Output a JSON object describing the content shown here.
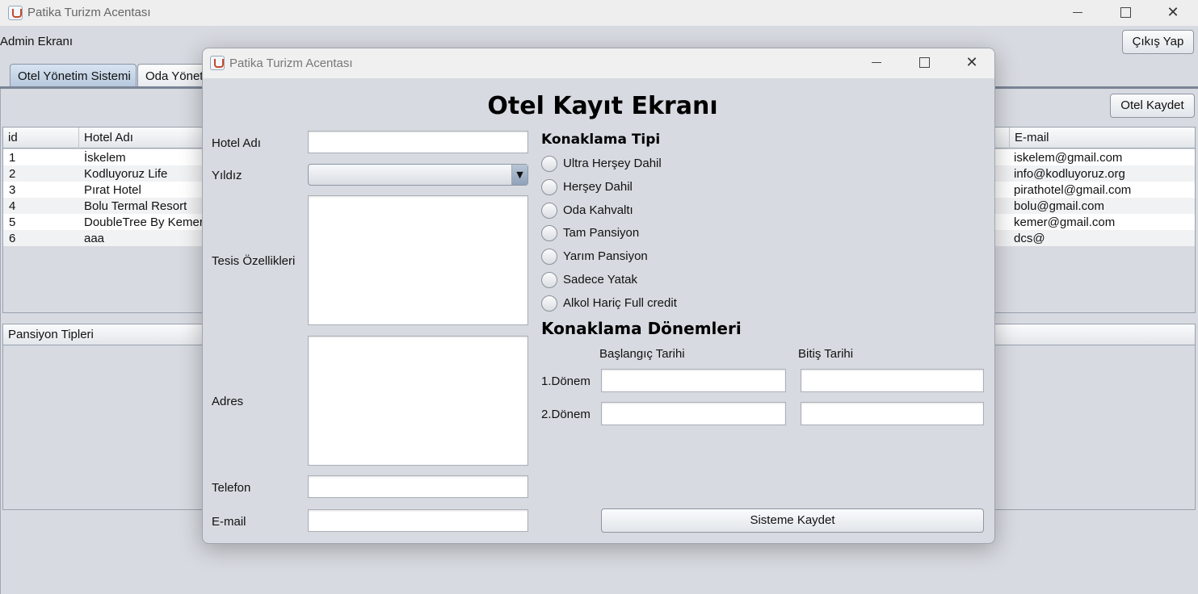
{
  "window": {
    "title": "Patika Turizm Acentası",
    "controls": {
      "minimize": "",
      "maximize": "",
      "close": "✕"
    }
  },
  "header": {
    "admin_label": "Admin Ekranı",
    "logout_label": "Çıkış Yap"
  },
  "tabs": [
    {
      "label": "Otel Yönetim Sistemi",
      "active": true
    },
    {
      "label": "Oda Yönetimi",
      "active": false
    }
  ],
  "hotel_panel": {
    "save_button_label": "Otel Kaydet",
    "table": {
      "columns": {
        "id": "id",
        "name": "Hotel Adı",
        "email": "E-mail"
      },
      "rows": [
        {
          "id": "1",
          "name": "İskelem",
          "email": "iskelem@gmail.com"
        },
        {
          "id": "2",
          "name": "Kodluyoruz Life",
          "email": "info@kodluyoruz.org"
        },
        {
          "id": "3",
          "name": "Pırat Hotel",
          "email": "pirathotel@gmail.com"
        },
        {
          "id": "4",
          "name": "Bolu Termal Resort",
          "email": "bolu@gmail.com"
        },
        {
          "id": "5",
          "name": "DoubleTree By Kemer",
          "email": "kemer@gmail.com"
        },
        {
          "id": "6",
          "name": "aaa",
          "email": "dcs@"
        }
      ]
    },
    "pansiyon_header": "Pansiyon Tipleri"
  },
  "dialog": {
    "window_title": "Patika Turizm Acentası",
    "controls": {
      "minimize": "",
      "maximize": "",
      "close": "✕"
    },
    "heading": "Otel Kayıt Ekranı",
    "fields": {
      "hotel_name": {
        "label": "Hotel Adı",
        "value": ""
      },
      "stars": {
        "label": "Yıldız",
        "value": ""
      },
      "facilities": {
        "label": "Tesis Özellikleri",
        "value": ""
      },
      "address": {
        "label": "Adres",
        "value": ""
      },
      "phone": {
        "label": "Telefon",
        "value": ""
      },
      "email": {
        "label": "E-mail",
        "value": ""
      }
    },
    "accommodation_type": {
      "title": "Konaklama Tipi",
      "options": [
        "Ultra Herşey Dahil",
        "Herşey Dahil",
        "Oda Kahvaltı",
        "Tam Pansiyon",
        "Yarım Pansiyon",
        "Sadece Yatak",
        "Alkol Hariç Full credit"
      ]
    },
    "periods": {
      "title": "Konaklama Dönemleri",
      "start_label": "Başlangıç Tarihi",
      "end_label": "Bitiş Tarihi",
      "rows": [
        {
          "label": "1.Dönem",
          "start": "",
          "end": ""
        },
        {
          "label": "2.Dönem",
          "start": "",
          "end": ""
        }
      ]
    },
    "save_label": "Sisteme Kaydet"
  }
}
